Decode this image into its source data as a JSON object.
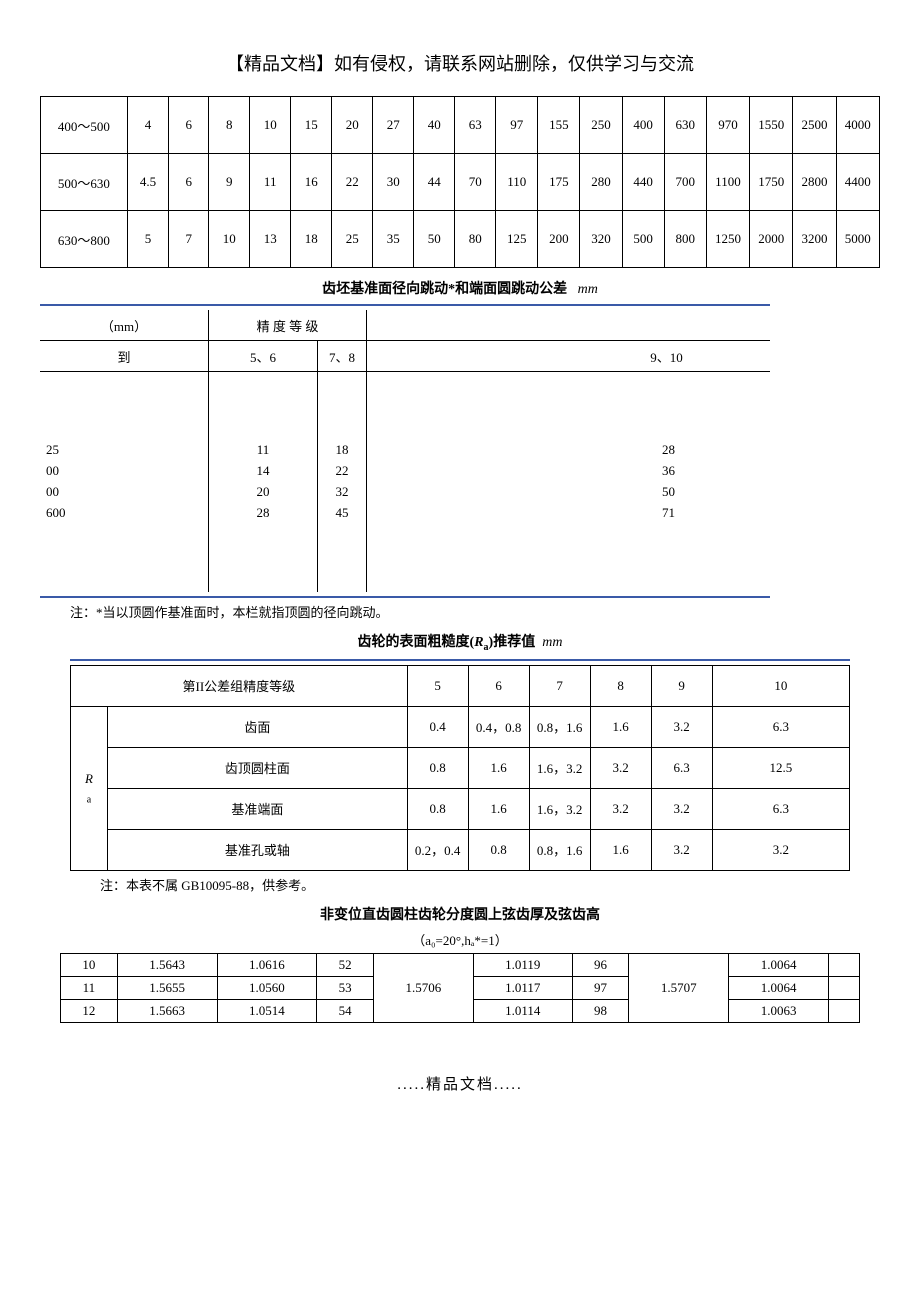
{
  "header": "【精品文档】如有侵权，请联系网站删除，仅供学习与交流",
  "table1": {
    "rows": [
      {
        "range": "400～500",
        "cells": [
          "4",
          "6",
          "8",
          "10",
          "15",
          "20",
          "27",
          "40",
          "63",
          "97",
          "155",
          "250",
          "400",
          "630",
          "970",
          "1550",
          "2500",
          "4000"
        ]
      },
      {
        "range": "500～630",
        "cells": [
          "4.5",
          "6",
          "9",
          "11",
          "16",
          "22",
          "30",
          "44",
          "70",
          "110",
          "175",
          "280",
          "440",
          "700",
          "1100",
          "1750",
          "2800",
          "4400"
        ]
      },
      {
        "range": "630～800",
        "cells": [
          "5",
          "7",
          "10",
          "13",
          "18",
          "25",
          "35",
          "50",
          "80",
          "125",
          "200",
          "320",
          "500",
          "800",
          "1250",
          "2000",
          "3200",
          "5000"
        ]
      }
    ]
  },
  "table2": {
    "title": "齿坯基准面径向跳动*和端面圆跳动公差",
    "unit": "mm",
    "header_mm": "（mm）",
    "header_level": "精 度 等 级",
    "col_to": "到",
    "cols": [
      "5、6",
      "7、8",
      "9、10"
    ],
    "rows": [
      {
        "to": "25",
        "a": "11",
        "b": "18",
        "c": "28"
      },
      {
        "to": "00",
        "a": "14",
        "b": "22",
        "c": "36"
      },
      {
        "to": "00",
        "a": "20",
        "b": "32",
        "c": "50"
      },
      {
        "to": "600",
        "a": "28",
        "b": "45",
        "c": "71"
      }
    ],
    "note": "注：*当以顶圆作基准面时，本栏就指顶圆的径向跳动。"
  },
  "table3": {
    "title_prefix": "齿轮的表面粗糙度(",
    "title_ra": "R",
    "title_ra_sub": "a",
    "title_suffix": ")推荐值",
    "unit": "mm",
    "header_group": "第II公差组精度等级",
    "levels": [
      "5",
      "6",
      "7",
      "8",
      "9",
      "10"
    ],
    "ra_label": "R",
    "ra_sub": "a",
    "rows": [
      {
        "name": "齿面",
        "vals": [
          "0.4",
          "0.4，0.8",
          "0.8，1.6",
          "1.6",
          "3.2",
          "6.3"
        ]
      },
      {
        "name": "齿顶圆柱面",
        "vals": [
          "0.8",
          "1.6",
          "1.6，3.2",
          "3.2",
          "6.3",
          "12.5"
        ]
      },
      {
        "name": "基准端面",
        "vals": [
          "0.8",
          "1.6",
          "1.6，3.2",
          "3.2",
          "3.2",
          "6.3"
        ]
      },
      {
        "name": "基准孔或轴",
        "vals": [
          "0.2，0.4",
          "0.8",
          "0.8，1.6",
          "1.6",
          "3.2",
          "3.2"
        ]
      }
    ],
    "note": "注：本表不属 GB10095-88，供参考。"
  },
  "table4": {
    "title": "非变位直齿圆柱齿轮分度圆上弦齿厚及弦齿高",
    "subtitle": "（a₀=20°,hₐ*=1）",
    "rows": [
      [
        "10",
        "1.5643",
        "1.0616",
        "52",
        "",
        "1.0119",
        "96",
        "",
        "1.0064"
      ],
      [
        "11",
        "1.5655",
        "1.0560",
        "53",
        "1.5706",
        "1.0117",
        "97",
        "1.5707",
        "1.0064"
      ],
      [
        "12",
        "1.5663",
        "1.0514",
        "54",
        "",
        "1.0114",
        "98",
        "",
        "1.0063"
      ]
    ]
  },
  "footer": ".....精品文档....."
}
